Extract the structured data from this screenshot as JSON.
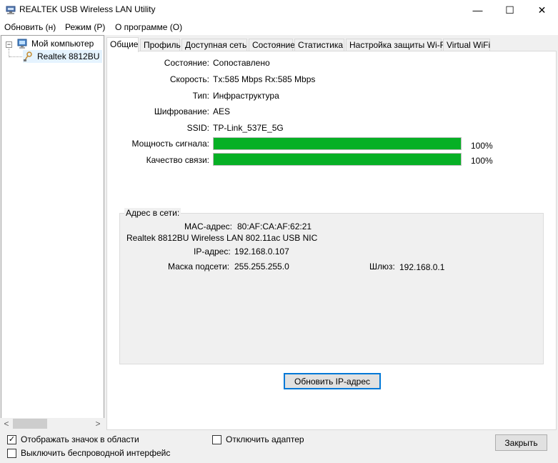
{
  "window": {
    "title": "REALTEK USB Wireless LAN Utility",
    "min_glyph": "—",
    "max_glyph": "☐",
    "close_glyph": "✕"
  },
  "menu": [
    "Обновить (н)",
    "Режим (Р)",
    "О программе (О)"
  ],
  "tree": {
    "root": "Мой компьютер",
    "child": "Realtek 8812BU"
  },
  "tabs": [
    "Общие",
    "Профиль",
    "Доступная сеть",
    "Состояние",
    "Статистика",
    "Настройка защиты Wi-Fi",
    "Virtual WiFi"
  ],
  "general": {
    "status_label": "Состояние:",
    "status_value": "Сопоставлено",
    "speed_label": "Скорость:",
    "speed_value": "Tx:585 Mbps Rx:585 Mbps",
    "type_label": "Тип:",
    "type_value": "Инфраструктура",
    "encryption_label": "Шифрование:",
    "encryption_value": "AES",
    "ssid_label": "SSID:",
    "ssid_value": "TP-Link_537E_5G",
    "signal_label": "Мощность сигнала:",
    "signal_percent": "100%",
    "signal_level": 100,
    "quality_label": "Качество связи:",
    "quality_percent": "100%",
    "quality_level": 100
  },
  "network": {
    "title": "Адрес в сети:",
    "mac_label": "MAC-адрес:",
    "mac_value": "80:AF:CA:AF:62:21",
    "adapter_name": "Realtek 8812BU Wireless LAN 802.11ac USB NIC",
    "ip_label": "IP-адрес:",
    "ip_value": "192.168.0.107",
    "mask_label": "Маска подсети:",
    "mask_value": "255.255.255.0",
    "gateway_label": "Шлюз:",
    "gateway_value": "192.168.0.1",
    "renew_button": "Обновить IP-адрес"
  },
  "bottom": {
    "show_tray_icon": "Отображать значок в области",
    "show_tray_checked": true,
    "disable_wireless": "Выключить беспроводной интерфейс",
    "disable_wireless_checked": false,
    "disable_adapter": "Отключить адаптер",
    "disable_adapter_checked": false,
    "close_button": "Закрыть"
  },
  "colors": {
    "signal_bar": "#06b025",
    "focus_border": "#0078d7"
  }
}
